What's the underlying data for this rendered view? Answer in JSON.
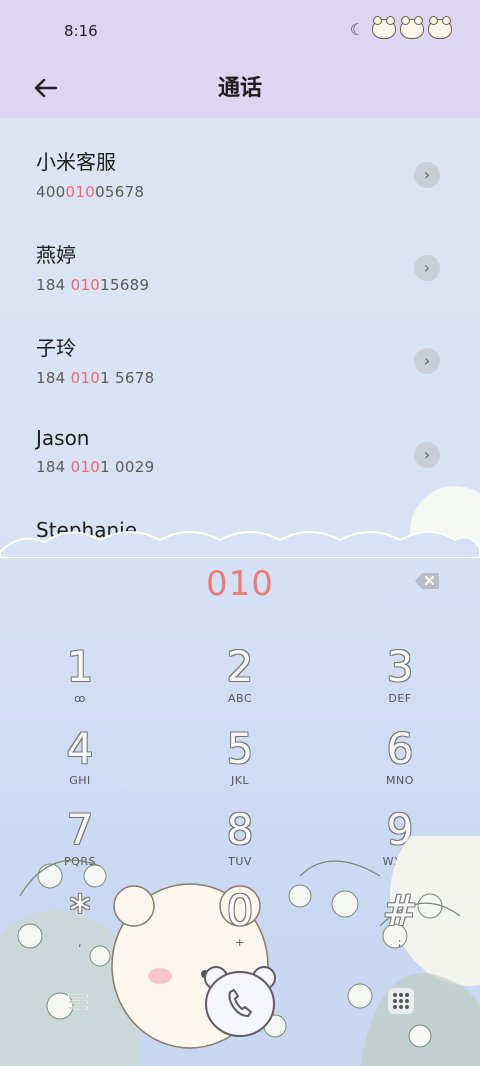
{
  "status_bar": {
    "time": "8:16",
    "icons": [
      "moon-icon",
      "bear-signal-icon",
      "bear-wifi-icon",
      "bear-battery-icon"
    ]
  },
  "header": {
    "title": "通话",
    "back_icon": "arrow-left-icon"
  },
  "contacts": [
    {
      "name": "小米客服",
      "number_parts": [
        "400",
        "010",
        "05678"
      ]
    },
    {
      "name": "燕婷",
      "number_parts": [
        "184 ",
        "010",
        "15689"
      ]
    },
    {
      "name": "子玲",
      "number_parts": [
        "184 ",
        "010",
        "1 5678"
      ]
    },
    {
      "name": "Jason",
      "number_parts": [
        "184 ",
        "010",
        "1 0029"
      ]
    },
    {
      "name": "Stephanie",
      "number_parts": [
        "",
        "",
        ""
      ]
    }
  ],
  "dialpad": {
    "entered_digits": "010",
    "keys": [
      {
        "num": "1",
        "sub": "ꝏ"
      },
      {
        "num": "2",
        "sub": "ABC"
      },
      {
        "num": "3",
        "sub": "DEF"
      },
      {
        "num": "4",
        "sub": "GHI"
      },
      {
        "num": "5",
        "sub": "JKL"
      },
      {
        "num": "6",
        "sub": "MNO"
      },
      {
        "num": "7",
        "sub": "PQRS"
      },
      {
        "num": "8",
        "sub": "TUV"
      },
      {
        "num": "9",
        "sub": "WXYZ"
      },
      {
        "num": "*",
        "sub": ","
      },
      {
        "num": "0",
        "sub": "+"
      },
      {
        "num": "#",
        "sub": ";"
      }
    ]
  },
  "colors": {
    "accent": "#e86a6a",
    "header_bg": "#ddd6f3"
  }
}
